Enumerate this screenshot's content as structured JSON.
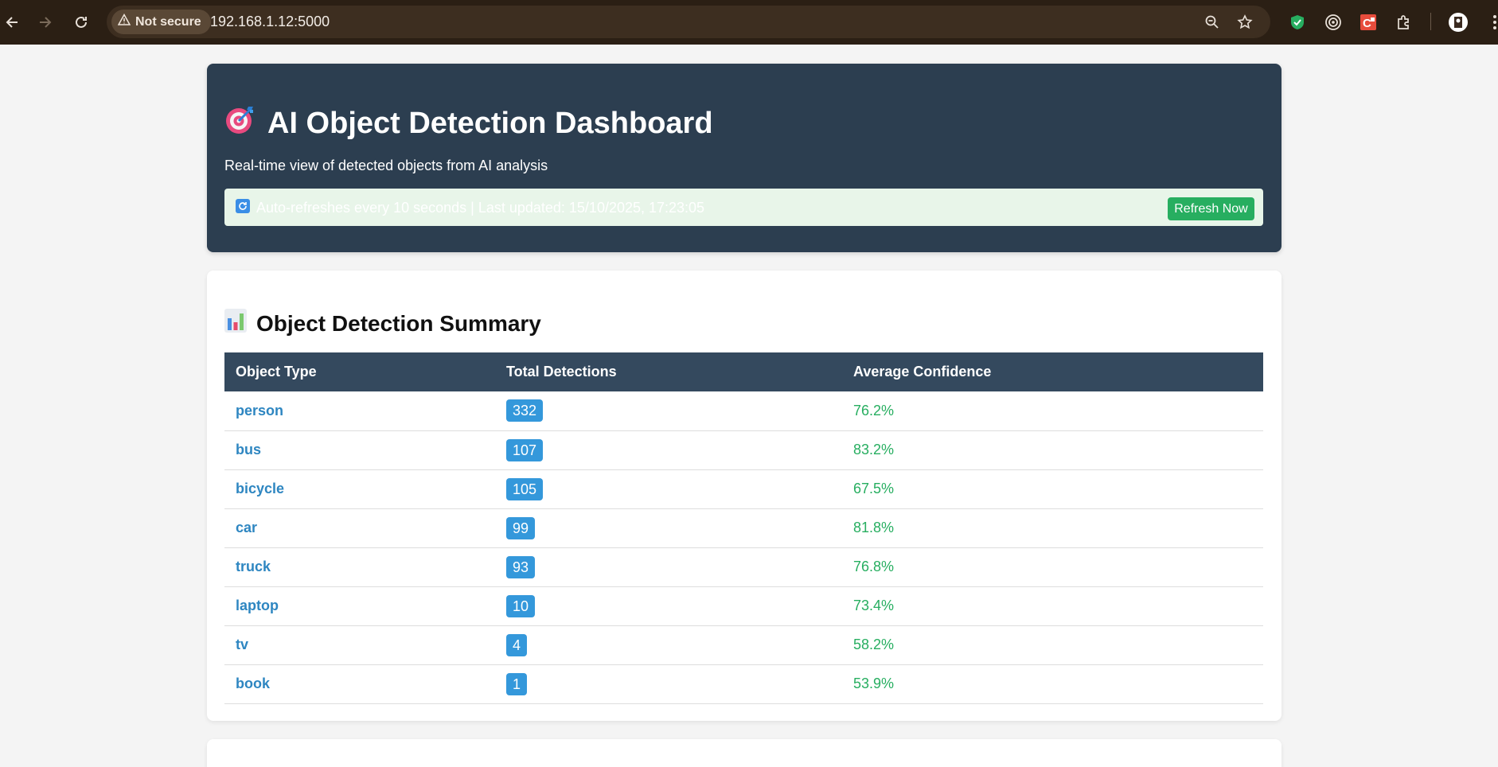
{
  "browser": {
    "security_label": "Not secure",
    "url": "192.168.1.12:5000",
    "icons": [
      "back-icon",
      "forward-icon",
      "reload-icon",
      "warning-icon",
      "zoom-icon",
      "star-icon",
      "shield-extension-icon",
      "target-extension-icon",
      "c-extension-icon",
      "puzzle-icon",
      "profile-avatar",
      "kebab-menu-icon"
    ]
  },
  "header": {
    "title": "AI Object Detection Dashboard",
    "title_icon": "target-emoji",
    "subtitle": "Real-time view of detected objects from AI analysis",
    "refresh_text": "Auto-refreshes every 10 seconds | Last updated: 15/10/2025, 17:23:05",
    "refresh_icon": "refresh-emoji",
    "refresh_button": "Refresh Now"
  },
  "summary": {
    "title": "Object Detection Summary",
    "title_icon": "bar-chart-emoji",
    "columns": [
      "Object Type",
      "Total Detections",
      "Average Confidence"
    ],
    "rows": [
      {
        "type": "person",
        "count": "332",
        "confidence": "76.2%"
      },
      {
        "type": "bus",
        "count": "107",
        "confidence": "83.2%"
      },
      {
        "type": "bicycle",
        "count": "105",
        "confidence": "67.5%"
      },
      {
        "type": "car",
        "count": "99",
        "confidence": "81.8%"
      },
      {
        "type": "truck",
        "count": "93",
        "confidence": "76.8%"
      },
      {
        "type": "laptop",
        "count": "10",
        "confidence": "73.4%"
      },
      {
        "type": "tv",
        "count": "4",
        "confidence": "58.2%"
      },
      {
        "type": "book",
        "count": "1",
        "confidence": "53.9%"
      }
    ]
  },
  "colors": {
    "header_bg": "#2c3e50",
    "table_header_bg": "#34495e",
    "link_blue": "#2e86c1",
    "badge_blue": "#3498db",
    "confidence_green": "#27ae60",
    "refresh_bar_bg": "#e8f5e9",
    "button_green": "#27ae60"
  }
}
